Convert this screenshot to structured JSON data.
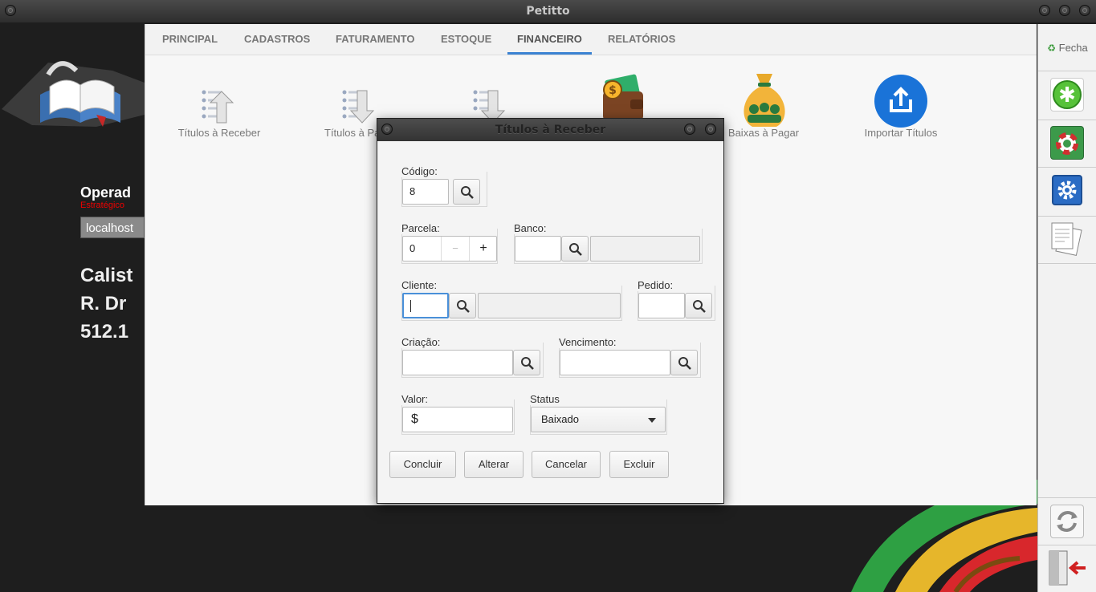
{
  "window": {
    "title": "Petitto"
  },
  "sidebar_left": {
    "operator_label": "Operad",
    "role": "Estratégico",
    "host": "localhost",
    "company_lines": [
      "Calist",
      "R. Dr",
      "512.1"
    ]
  },
  "tabs": [
    {
      "label": "PRINCIPAL"
    },
    {
      "label": "CADASTROS"
    },
    {
      "label": "FATURAMENTO"
    },
    {
      "label": "ESTOQUE"
    },
    {
      "label": "FINANCEIRO",
      "active": true
    },
    {
      "label": "RELATÓRIOS"
    }
  ],
  "tools": {
    "titulos_receber": "Títulos à Receber",
    "titulos_pagar": "Títulos à Pa",
    "baixas_pagar": "Baixas à Pagar",
    "importar": "Importar Títulos"
  },
  "right_toolbar": {
    "fecha": "Fecha"
  },
  "dialog": {
    "title": "Títulos à Receber",
    "codigo": {
      "label": "Código:",
      "value": "8"
    },
    "parcela": {
      "label": "Parcela:",
      "value": "0",
      "minus": "−",
      "plus": "+"
    },
    "banco": {
      "label": "Banco:",
      "value": "",
      "name": ""
    },
    "cliente": {
      "label": "Cliente:",
      "value": "",
      "name": ""
    },
    "pedido": {
      "label": "Pedido:",
      "value": ""
    },
    "criacao": {
      "label": "Criação:",
      "value": ""
    },
    "vencimento": {
      "label": "Vencimento:",
      "value": ""
    },
    "valor": {
      "label": "Valor:",
      "prefix": "$",
      "value": ""
    },
    "status": {
      "label": "Status",
      "value": "Baixado"
    },
    "buttons": {
      "concluir": "Concluir",
      "alterar": "Alterar",
      "cancelar": "Cancelar",
      "excluir": "Excluir"
    }
  },
  "colors": {
    "accent": "#3a82d2",
    "green": "#44b02c",
    "red": "#e00000"
  }
}
